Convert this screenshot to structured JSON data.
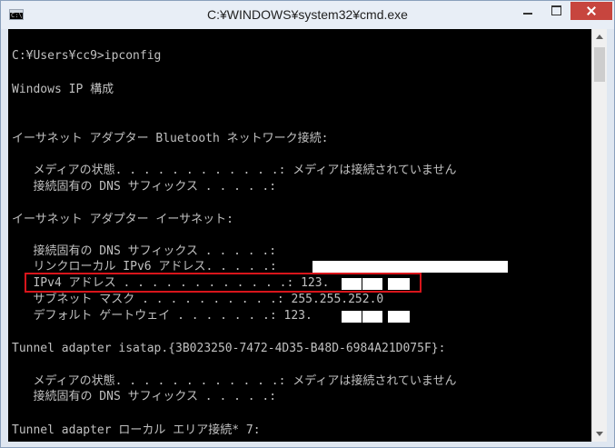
{
  "window": {
    "title": "C:¥WINDOWS¥system32¥cmd.exe",
    "icon": "cmd-icon",
    "controls": [
      "minimize-icon",
      "maximize-icon",
      "close-icon"
    ],
    "close_color": "#c7453e"
  },
  "console": {
    "background": "#000000",
    "foreground": "#c0c0c0",
    "highlight_color": "#d8151b",
    "lines": [
      "C:¥Users¥cc9>ipconfig",
      "Windows IP 構成",
      "イーサネット アダプター Bluetooth ネットワーク接続:",
      "   メディアの状態. . . . . . . . . . . .: メディアは接続されていません",
      "   接続固有の DNS サフィックス . . . . .:",
      "イーサネット アダプター イーサネット:",
      "   接続固有の DNS サフィックス . . . . .:",
      "   リンクローカル IPv6 アドレス. . . . .:",
      "   IPv4 アドレス . . . . . . . . . . . .: 123.",
      "   サブネット マスク . . . . . . . . . .: 255.255.252.0",
      "   デフォルト ゲートウェイ . . . . . . .: 123.",
      "Tunnel adapter isatap.{3B023250-7472-4D35-B48D-6984A21D075F}:",
      "   メディアの状態. . . . . . . . . . . .: メディアは接続されていません",
      "   接続固有の DNS サフィックス . . . . .:",
      "Tunnel adapter ローカル エリア接続* 7:"
    ]
  },
  "scrollbar": {
    "up": "scroll-up-arrow-icon",
    "down": "scroll-down-arrow-icon"
  }
}
